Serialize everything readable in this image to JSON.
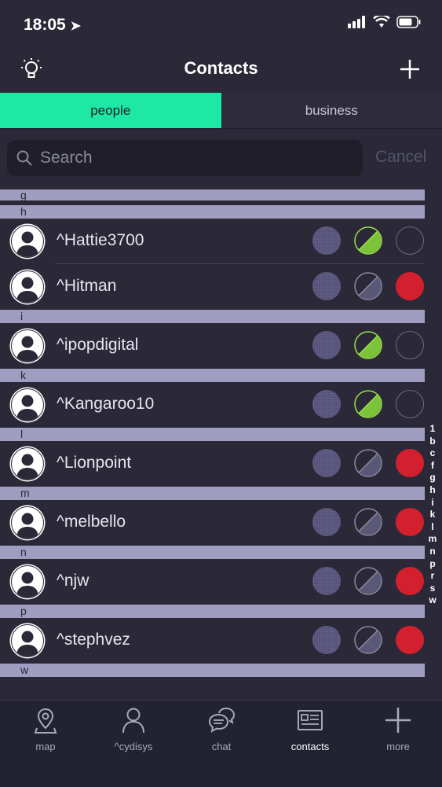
{
  "status": {
    "time": "18:05"
  },
  "header": {
    "title": "Contacts"
  },
  "tabs": [
    {
      "label": "people"
    },
    {
      "label": "business"
    }
  ],
  "search": {
    "placeholder": "Search",
    "cancel": "Cancel"
  },
  "sections": [
    {
      "letter": "g",
      "contacts": []
    },
    {
      "letter": "h",
      "contacts": [
        {
          "name": "^Hattie3700",
          "c2": "green",
          "c3": "empty"
        },
        {
          "name": "^Hitman",
          "c2": "gray",
          "c3": "red"
        }
      ]
    },
    {
      "letter": "i",
      "contacts": [
        {
          "name": "^ipopdigital",
          "c2": "green",
          "c3": "empty"
        }
      ]
    },
    {
      "letter": "k",
      "contacts": [
        {
          "name": "^Kangaroo10",
          "c2": "green",
          "c3": "empty"
        }
      ]
    },
    {
      "letter": "l",
      "contacts": [
        {
          "name": "^Lionpoint",
          "c2": "gray",
          "c3": "red"
        }
      ]
    },
    {
      "letter": "m",
      "contacts": [
        {
          "name": "^melbello",
          "c2": "gray",
          "c3": "red"
        }
      ]
    },
    {
      "letter": "n",
      "contacts": [
        {
          "name": "^njw",
          "c2": "gray",
          "c3": "red"
        }
      ]
    },
    {
      "letter": "p",
      "contacts": [
        {
          "name": "^stephvez",
          "c2": "gray",
          "c3": "red"
        }
      ]
    },
    {
      "letter": "w",
      "contacts": []
    }
  ],
  "alpha_index": [
    "1",
    "b",
    "c",
    "f",
    "g",
    "h",
    "i",
    "k",
    "l",
    "m",
    "n",
    "p",
    "r",
    "s",
    "w"
  ],
  "bottom_nav": [
    {
      "label": "map",
      "icon": "map-pin-icon"
    },
    {
      "label": "^cydisys",
      "icon": "person-icon"
    },
    {
      "label": "chat",
      "icon": "chat-icon"
    },
    {
      "label": "contacts",
      "icon": "contacts-card-icon"
    },
    {
      "label": "more",
      "icon": "plus-icon"
    }
  ],
  "colors": {
    "accent": "#1de9a5",
    "red": "#d4202e",
    "green": "#9be24a",
    "purple": "#5a5877",
    "section": "#a09ec0"
  }
}
